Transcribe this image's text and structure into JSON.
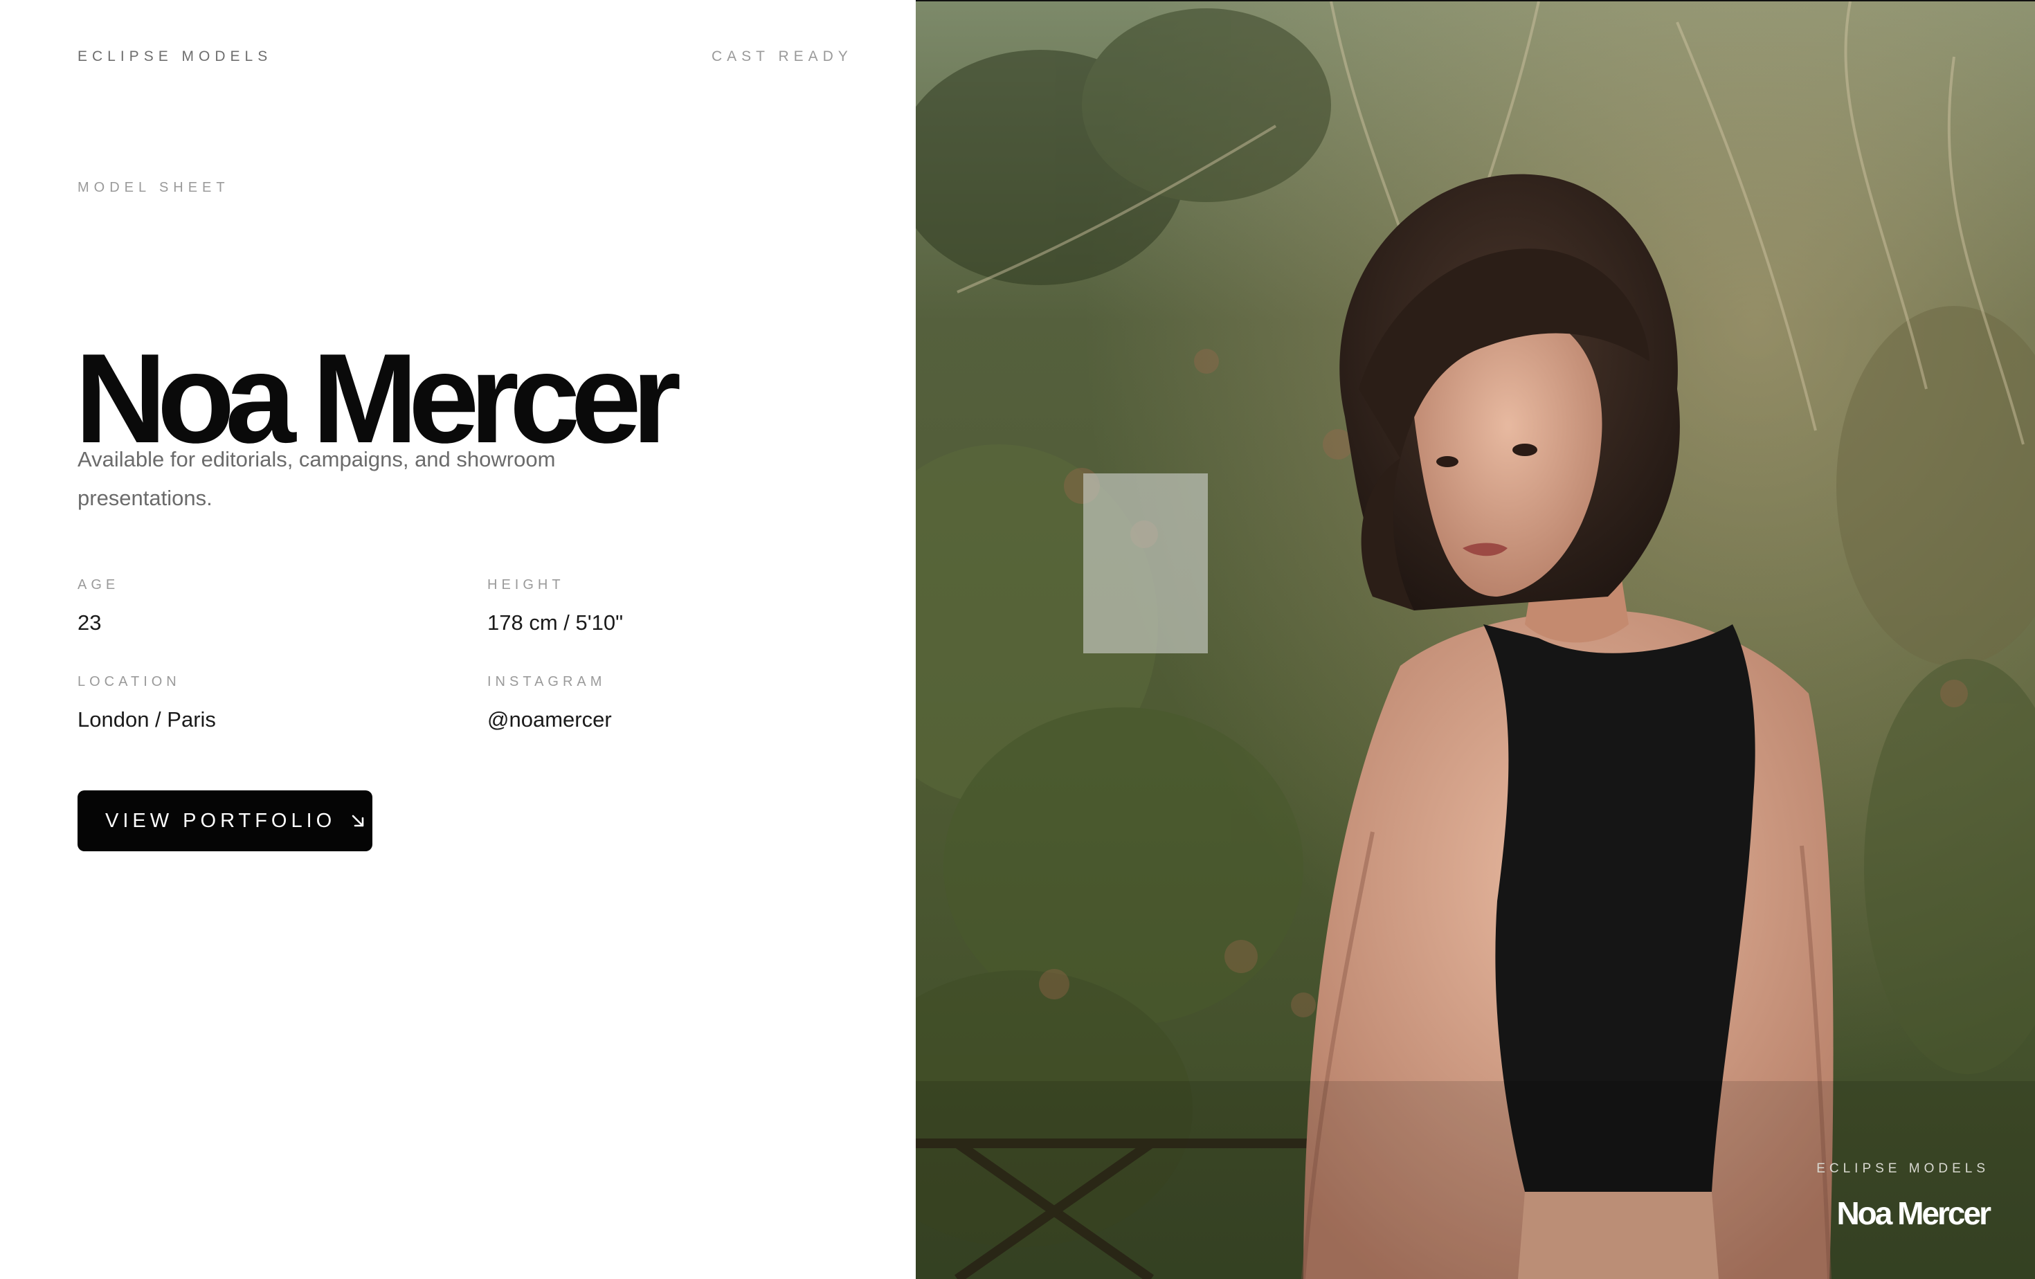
{
  "header": {
    "brand": "ECLIPSE MODELS",
    "status": "CAST READY"
  },
  "profile": {
    "eyebrow": "MODEL SHEET",
    "name": "Noa Mercer",
    "blurb": "Available for editorials, campaigns, and showroom presentations.",
    "fields": {
      "age": {
        "label": "AGE",
        "value": "23"
      },
      "height": {
        "label": "HEIGHT",
        "value": "178 cm / 5'10\""
      },
      "location": {
        "label": "LOCATION",
        "value": "London / Paris"
      },
      "instagram": {
        "label": "INSTAGRAM",
        "value": "@noamercer"
      }
    },
    "cta": {
      "label": "VIEW PORTFOLIO",
      "icon": "arrow-down-right-icon"
    }
  },
  "photo": {
    "caption_brand": "ECLIPSE MODELS",
    "caption_name": "Noa Mercer"
  },
  "colors": {
    "ink": "#0a0a0a",
    "muted": "#9a9a9a",
    "button": "#050505",
    "foliage": "#4b5a32"
  }
}
